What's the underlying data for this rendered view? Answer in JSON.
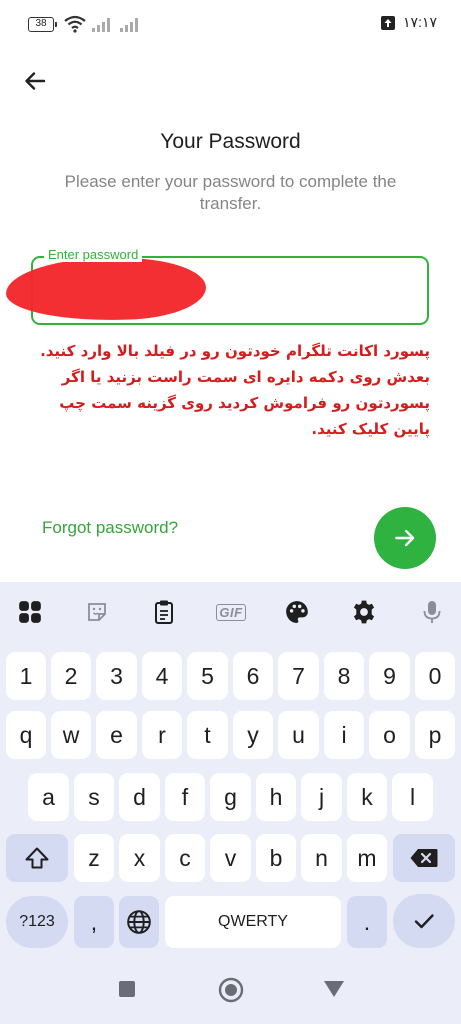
{
  "status_bar": {
    "battery": "38",
    "time": "۱۷:۱۷"
  },
  "header": {
    "title": "Your Password",
    "subtitle": "Please enter your password to complete the transfer."
  },
  "password_field": {
    "label": "Enter password",
    "value": ""
  },
  "annotation": {
    "text": "پسورد اکانت تلگرام خودتون رو در فیلد بالا وارد کنید.\nبعدش روی دکمه دایره ای سمت راست بزنید یا اگر\nپسوردتون رو فراموش کردید روی گزینه سمت چپ\nپایین کلیک کنید.",
    "color": "#d41d1d"
  },
  "forgot_link": "Forgot password?",
  "accent_color": "#2fb240",
  "keyboard": {
    "toolbar": {
      "gif_label": "GIF",
      "icons": [
        "apps-grid-icon",
        "sticker-icon",
        "clipboard-icon",
        "gif-icon",
        "palette-icon",
        "settings-gear-icon",
        "microphone-icon"
      ]
    },
    "number_row": [
      "1",
      "2",
      "3",
      "4",
      "5",
      "6",
      "7",
      "8",
      "9",
      "0"
    ],
    "row1": [
      "q",
      "w",
      "e",
      "r",
      "t",
      "y",
      "u",
      "i",
      "o",
      "p"
    ],
    "row2": [
      "a",
      "s",
      "d",
      "f",
      "g",
      "h",
      "j",
      "k",
      "l"
    ],
    "row3": [
      "z",
      "x",
      "c",
      "v",
      "b",
      "n",
      "m"
    ],
    "symbols_key": "?123",
    "comma_key": ",",
    "space_label": "QWERTY",
    "period_key": "."
  },
  "navbar": {
    "icons": [
      "recent-apps-icon",
      "home-icon",
      "back-triangle-icon"
    ]
  }
}
